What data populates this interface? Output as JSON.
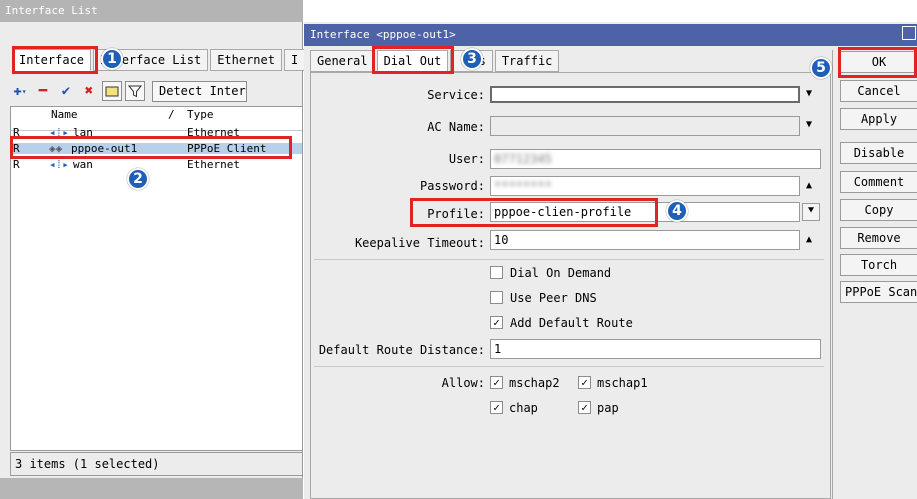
{
  "left_window": {
    "title": "Interface List",
    "tabs": [
      "Interface",
      "Interface List",
      "Ethernet",
      "I"
    ],
    "toolbar": {
      "add_icon": "plus-icon",
      "remove_icon": "minus-icon",
      "enable_icon": "check-icon",
      "disable_icon": "x-icon",
      "comment_icon": "note-icon",
      "filter_icon": "filter-icon",
      "detect_label": "Detect Inter"
    },
    "columns": [
      "Name",
      "Type"
    ],
    "sort_indicator": "/",
    "rows": [
      {
        "flag": "R",
        "icon": "interface-icon",
        "name": "lan",
        "type": "Ethernet"
      },
      {
        "flag": "R",
        "icon": "pppoe-icon",
        "name": "pppoe-out1",
        "type": "PPPoE Client"
      },
      {
        "flag": "R",
        "icon": "interface-icon",
        "name": "wan",
        "type": "Ethernet"
      }
    ],
    "status": "3 items (1 selected)"
  },
  "right_window": {
    "title": "Interface <pppoe-out1>",
    "tabs": [
      "General",
      "Dial Out",
      "Status",
      "Traffic"
    ],
    "visible_tabs": [
      "General",
      "Dial Out",
      "us",
      "Traffic"
    ],
    "fields": {
      "service_label": "Service:",
      "service_value": "",
      "ac_name_label": "AC Name:",
      "ac_name_value": "",
      "user_label": "User:",
      "user_value": "07712345",
      "password_label": "Password:",
      "password_value": "********",
      "profile_label": "Profile:",
      "profile_value": "pppoe-clien-profile",
      "keepalive_label": "Keepalive Timeout:",
      "keepalive_value": "10",
      "distance_label": "Default Route Distance:",
      "distance_value": "1",
      "allow_label": "Allow:"
    },
    "checkboxes": {
      "dial_on_demand": {
        "label": "Dial On Demand",
        "checked": false
      },
      "use_peer_dns": {
        "label": "Use Peer DNS",
        "checked": false
      },
      "add_default_route": {
        "label": "Add Default Route",
        "checked": true
      }
    },
    "allow": [
      {
        "label": "mschap2",
        "checked": true
      },
      {
        "label": "mschap1",
        "checked": true
      },
      {
        "label": "chap",
        "checked": true
      },
      {
        "label": "pap",
        "checked": true
      }
    ],
    "buttons": [
      "OK",
      "Cancel",
      "Apply",
      "Disable",
      "Comment",
      "Copy",
      "Remove",
      "Torch",
      "PPPoE Scan"
    ],
    "check_glyph": "✓"
  },
  "annotations": {
    "badges": [
      "1",
      "2",
      "3",
      "4",
      "5"
    ],
    "highlight_color": "#e02424",
    "badge_color": "#1f5fb8"
  },
  "colors": {
    "active_title": "#4e62a8",
    "inactive_title": "#b4b4b4",
    "selection": "#b8d0ea"
  }
}
